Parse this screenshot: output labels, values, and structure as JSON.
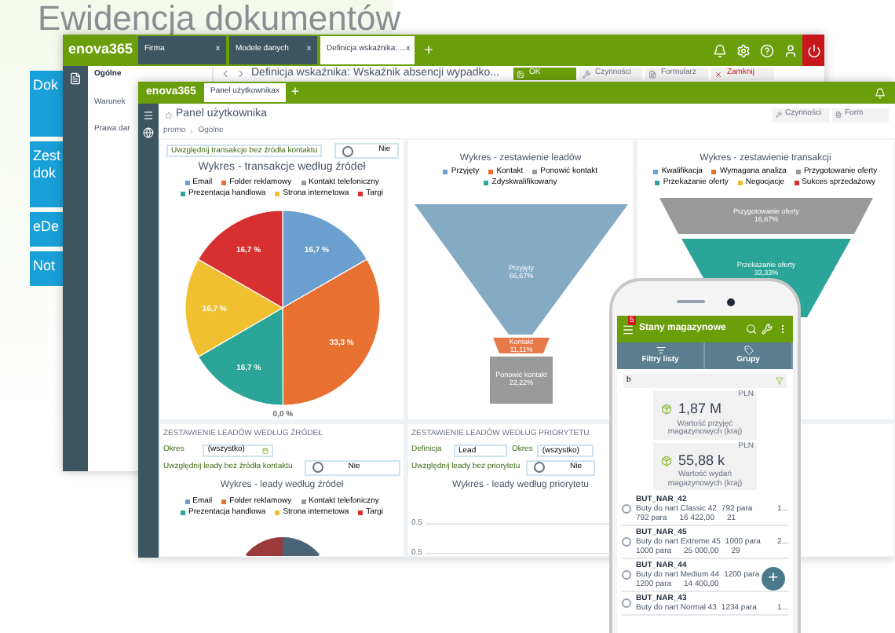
{
  "back_window": {
    "title": "Ewidencja dokumentów",
    "tiles": [
      "Dok",
      "Zest dok",
      "eDe",
      "Not"
    ]
  },
  "main_window": {
    "logo": "enova365",
    "tabs": [
      {
        "label": "Firma",
        "close": "x",
        "selected": false
      },
      {
        "label": "Modele danych",
        "close": "x",
        "selected": false
      },
      {
        "label": "Definicja wskaźnika: ...",
        "close": "x",
        "selected": true
      }
    ],
    "add_tab": "+",
    "menu": [
      {
        "label": "Ogólne",
        "selected": true
      },
      {
        "label": "Warunek",
        "selected": false
      },
      {
        "label": "Prawa dar",
        "selected": false
      }
    ],
    "title": "Definicja wskaźnika: Wskaźnik absencji wypadko...",
    "buttons": [
      {
        "kind": "ok",
        "label": "OK"
      },
      {
        "kind": "actions",
        "label": "Czynności"
      },
      {
        "kind": "form",
        "label": "Formularz"
      },
      {
        "kind": "close",
        "label": "Zamknij"
      }
    ]
  },
  "panel_window": {
    "logo": "enova365",
    "tabs": [
      {
        "label": "Panel użytkownika",
        "close": "x",
        "selected": true
      }
    ],
    "add_tab": "+",
    "title": "Panel użytkownika",
    "buttons": [
      "Czynności",
      "Form"
    ],
    "breadcrumb": [
      "promo",
      "Ogólne"
    ],
    "pie_panel": {
      "option": {
        "label": "Uwzględnij transakcje bez źródła kontaktu",
        "value": "Nie",
        "checked": false
      },
      "legend": [
        {
          "color": "#6a9fd0"
        },
        {
          "color": "#e87030"
        },
        {
          "color": "#999999"
        },
        {
          "color": "#2aa598"
        },
        {
          "color": "#f0c030"
        },
        {
          "color": "#d83030"
        }
      ],
      "chart_data": {
        "type": "pie",
        "title": "Wykres - transakcje według źródeł",
        "categories": [
          "Email",
          "Folder reklamowy",
          "Kontakt telefoniczny",
          "Prezentacja handlowa",
          "Strona internetowa",
          "Targi"
        ],
        "values": [
          16.7,
          33.3,
          0,
          16.7,
          16.7,
          16.7
        ],
        "value_labels": [
          "16,7 %",
          "33,3 %",
          "0,0 %",
          "16,7 %",
          "16,7 %",
          "16,7 %"
        ]
      }
    },
    "leads_funnel": {
      "title": "Wykres - zestawienie leadów",
      "legend": [
        {
          "label": "Przyjęty",
          "color": "#6a9fd0"
        },
        {
          "label": "Kontakt",
          "color": "#e87030"
        },
        {
          "label": "Ponowić kontakt",
          "color": "#999999"
        },
        {
          "label": "Zdyskwalifikowany",
          "color": "#2aa598"
        }
      ],
      "stages": [
        {
          "label": "Przyjęty",
          "value": "66,67%"
        },
        {
          "label": "Kontakt",
          "value": "11,11%"
        },
        {
          "label": "Ponowić kontakt",
          "value": "22,22%"
        }
      ]
    },
    "deals_funnel": {
      "title": "Wykres - zestawienie transakcji",
      "legend": [
        {
          "label": "Kwalifikacja",
          "color": "#6a9fd0"
        },
        {
          "label": "Wymagana analiza",
          "color": "#e87030"
        },
        {
          "label": "Przygotowanie oferty",
          "color": "#999999"
        },
        {
          "label": "Przekazanie oferty",
          "color": "#2aa598"
        },
        {
          "label": "Negocjacje",
          "color": "#f0c030"
        },
        {
          "label": "Sukces sprzedażowy",
          "color": "#d83030"
        }
      ],
      "stages": [
        {
          "label": "Przygotowanie oferty",
          "value": "16,67%"
        },
        {
          "label": "Przekazanie oferty",
          "value": "33,33%"
        }
      ]
    },
    "leads_by_source": {
      "heading": "ZESTAWIENIE LEADÓW WEDŁUG ŹRÓDEŁ",
      "period_label": "Okres",
      "period": "(wszystko)",
      "option": {
        "label": "Uwzględnij leady bez źródła kontaktu",
        "value": "Nie",
        "checked": false
      },
      "title": "Wykres - leady według źródeł",
      "legend": [
        {
          "label": "Email",
          "color": "#6a9fd0"
        },
        {
          "label": "Folder reklamowy",
          "color": "#e87030"
        },
        {
          "label": "Kontakt telefoniczny",
          "color": "#999999"
        },
        {
          "label": "Prezentacja handlowa",
          "color": "#2aa598"
        },
        {
          "label": "Strona internetowa",
          "color": "#f0c030"
        },
        {
          "label": "Targi",
          "color": "#d83030"
        }
      ]
    },
    "leads_by_priority": {
      "heading": "ZESTAWIENIE LEADÓW WEDŁUG PRIORYTETU",
      "definition_label": "Definicja",
      "definition": "Lead",
      "period_label": "Okres",
      "period": "(wszystko)",
      "option": {
        "label": "Uwzględnij leady bez priorytetu",
        "value": "Nie",
        "checked": false
      },
      "title": "Wykres - leady według priorytetu",
      "ticks": [
        "0.5",
        "0.5"
      ]
    }
  },
  "phone": {
    "badge": "5",
    "title": "Stany magazynowe",
    "actions": [
      "Filtry listy",
      "Grupy"
    ],
    "search": "b",
    "cards": [
      {
        "currency": "PLN",
        "value": "1,87 M",
        "label": "Wartość przyjęć magazynowych (kraj)"
      },
      {
        "currency": "PLN",
        "value": "55,88 k",
        "label": "Wartość wydań magazynowych (kraj)"
      }
    ],
    "items": [
      {
        "code": "BUT_NAR_42",
        "name": "Buty do nart Classic 42",
        "qty": "792 para",
        "extra": "1...",
        "qty2": "792 para",
        "amount": "16 422,00",
        "col": "21",
        "checked": false
      },
      {
        "code": "BUT_NAR_45",
        "name": "Buty do nart Extreme 45",
        "qty": "1000 para",
        "extra": "2...",
        "qty2": "1000 para",
        "amount": "25 000,00",
        "col": "29",
        "checked": false
      },
      {
        "code": "BUT_NAR_44",
        "name": "Buty do nart Medium 44",
        "qty": "1200 para",
        "qty2": "1200 para",
        "amount": "14 400,00",
        "checked": false
      },
      {
        "code": "BUT_NAR_43",
        "name": "Buty do nart Normal 43",
        "qty": "1234 para",
        "extra": "1...",
        "checked": false
      }
    ],
    "fab": "+"
  }
}
